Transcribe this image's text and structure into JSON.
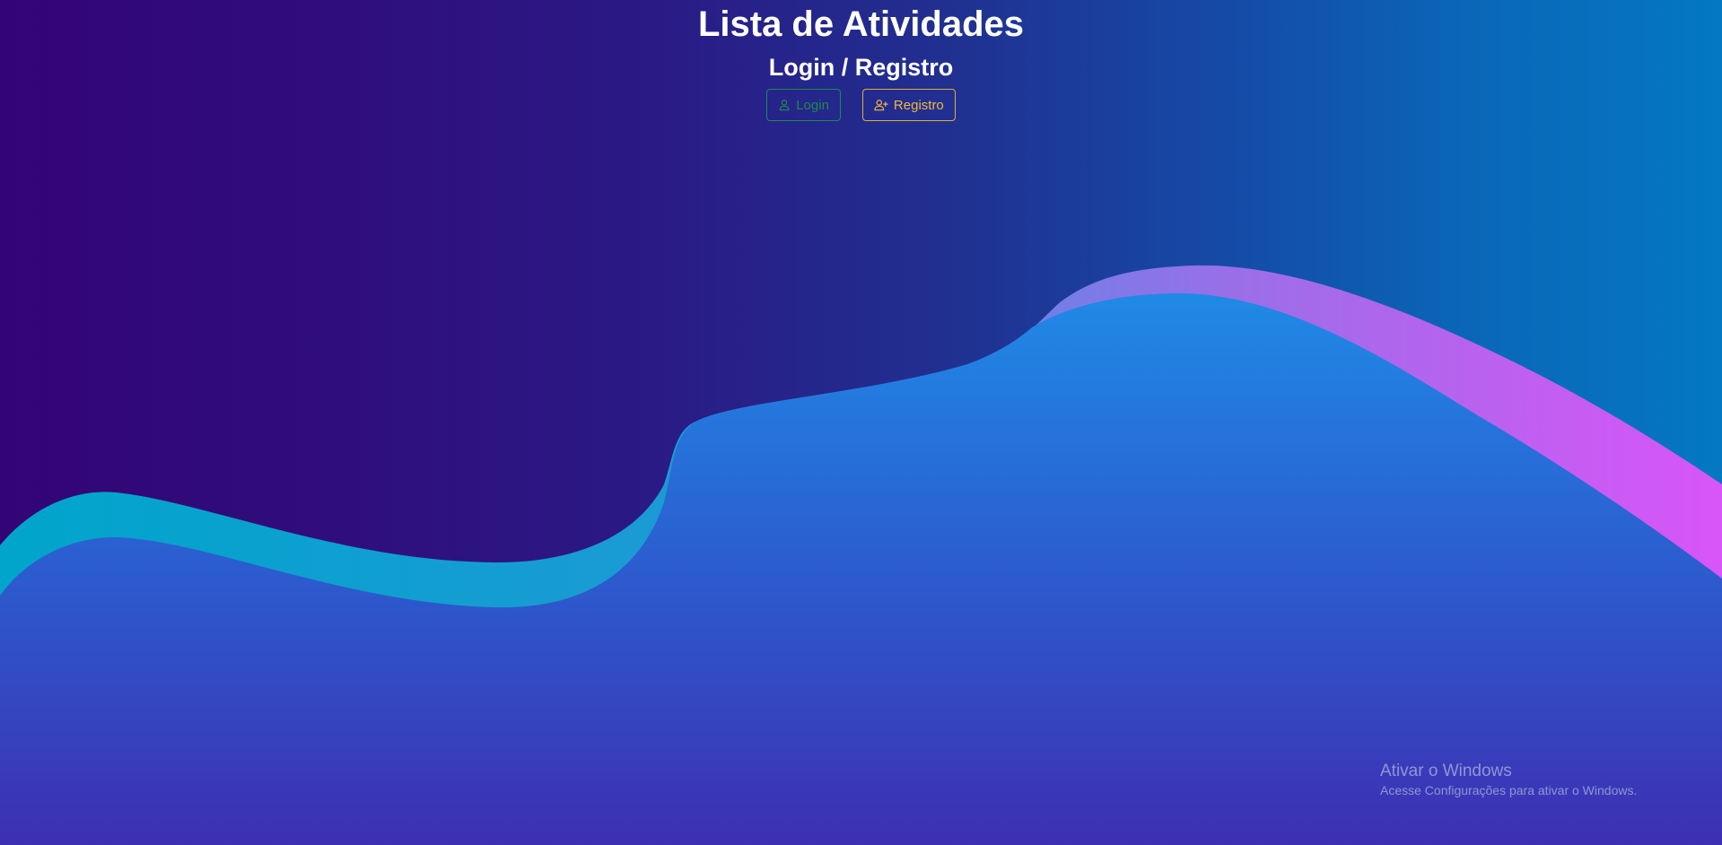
{
  "header": {
    "title": "Lista de Atividades",
    "subtitle": "Login / Registro"
  },
  "buttons": {
    "login": {
      "label": "Login",
      "icon": "user-icon",
      "color": "#1f8a4c"
    },
    "register": {
      "label": "Registro",
      "icon": "user-plus-icon",
      "color": "#f0b73e"
    }
  },
  "watermark": {
    "title": "Ativar o Windows",
    "subtitle": "Acesse Configurações para ativar o Windows."
  },
  "colors": {
    "background_left": "#330475",
    "background_right": "#0478c2",
    "wave_back_left": "#00a5cc",
    "wave_back_right": "#d855f7",
    "wave_front_top": "#1f8ae6",
    "wave_front_bottom": "#3d2fb2"
  }
}
